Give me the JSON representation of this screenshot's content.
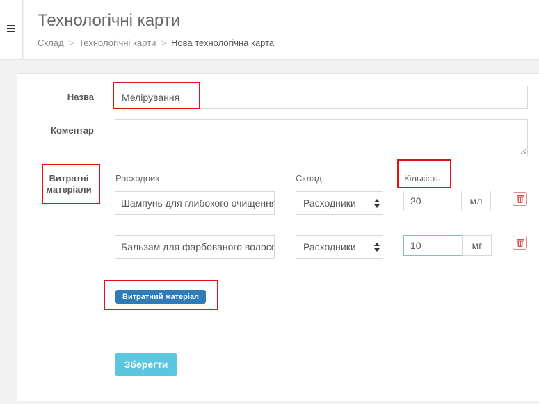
{
  "header": {
    "title": "Технологічні карти",
    "breadcrumb": [
      "Склад",
      "Технологічні карти",
      "Нова технологічна карта"
    ],
    "separator": ">"
  },
  "form": {
    "name_label": "Назва",
    "name_value": "Мелірування",
    "comment_label": "Коментар",
    "comment_value": "",
    "materials_label_line1": "Витратні",
    "materials_label_line2": "матеріали",
    "columns": {
      "item": "Расходник",
      "warehouse": "Склад",
      "qty": "Кількість"
    },
    "rows": [
      {
        "item": "Шампунь для глибокого очищення",
        "warehouse": "Расходники",
        "qty": "20",
        "unit": "мл"
      },
      {
        "item": "Бальзам для фарбованого волосся",
        "warehouse": "Расходники",
        "qty": "10",
        "unit": "мг"
      }
    ],
    "add_button": "Витратний матеріал",
    "save_button": "Зберегти"
  },
  "colors": {
    "primary": "#2e7bb9",
    "save": "#5bc6e0",
    "delete": "#d9534f",
    "highlight": "#e21212"
  }
}
